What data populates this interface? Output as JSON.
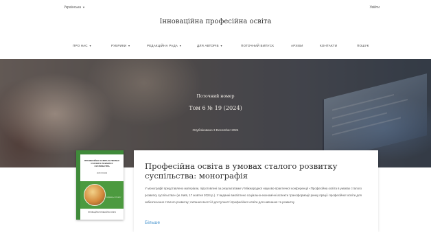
{
  "header": {
    "language": "Українська",
    "login": "Увійти",
    "site_title": "Інноваційна професійна освіта"
  },
  "nav": {
    "about": "ПРО НАС",
    "sections": "РУБРИКИ",
    "editorial_board": "РЕДАКЦІЙНА РАДА",
    "for_authors": "ДЛЯ АВТОРІВ",
    "current_issue": "ПОТОЧНИЙ ВИПУСК",
    "archive": "АРХІВИ",
    "contacts": "КОНТАКТИ",
    "search": "ПОШУК"
  },
  "hero": {
    "issue_label": "Поточний номер",
    "issue_title": "Том 6 № 19 (2024)",
    "published": "Опубліковано 3 December 2024"
  },
  "cover": {
    "title": "ПРОФЕСІЙНА ОСВІТА В УМОВАХ СТАЛОГО РОЗВИТКУ СУСПІЛЬСТВА",
    "subtitle": "МОНОГРАФІЯ",
    "publisher": "ВИДАВЕЦЬ ЖУРНАЛУ",
    "bottom": "ІННОВАЦІЙНА ПРОФЕСІЙНА ОСВІТА"
  },
  "article": {
    "title": "Професійна освіта в умовах сталого розвитку суспільства: монографія",
    "description": "У монографії представлено матеріали, підготовлені за результатами V Міжнародної науково-практичної конференції «Професійна освіта в умовах сталого розвитку суспільства» (м. Київ, 17 жовтня 2024 р.). У виданні висвітлено соціально-економічні аспекти трансформації ринку праці і професійної освіти для забезпечення сталого розвитку; питання якості й доступності професійної освіти для навчання та розвитку",
    "more": "Більше"
  },
  "colors": {
    "accent_link": "#3f8fcc",
    "cover_green": "#3f8a3a"
  },
  "icons": {
    "dropdown": "chevron-down-icon"
  }
}
